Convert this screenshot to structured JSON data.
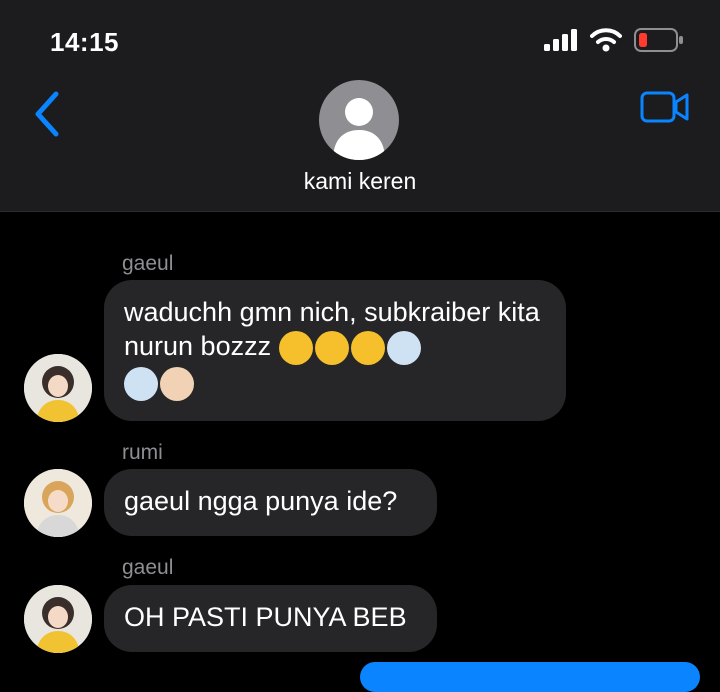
{
  "status_bar": {
    "time": "14:15"
  },
  "header": {
    "group_name": "kami keren"
  },
  "messages": [
    {
      "sender": "gaeul",
      "text": "waduchh gmn nich, subkraiber kita nurun bozzz"
    },
    {
      "sender": "rumi",
      "text": "gaeul ngga punya ide?"
    },
    {
      "sender": "gaeul",
      "text": "OH PASTI PUNYA BEB"
    }
  ],
  "icons": {
    "back": "chevron-left",
    "video": "video-camera",
    "signal": "cellular-signal",
    "wifi": "wifi",
    "battery": "battery-low",
    "emoji_1": "face-with-tears-of-joy",
    "emoji_2": "face-screaming-in-fear",
    "emoji_3": "ok-hand"
  },
  "colors": {
    "accent": "#0a84ff",
    "bubble": "#262628",
    "battery_low": "#ff3b30"
  }
}
